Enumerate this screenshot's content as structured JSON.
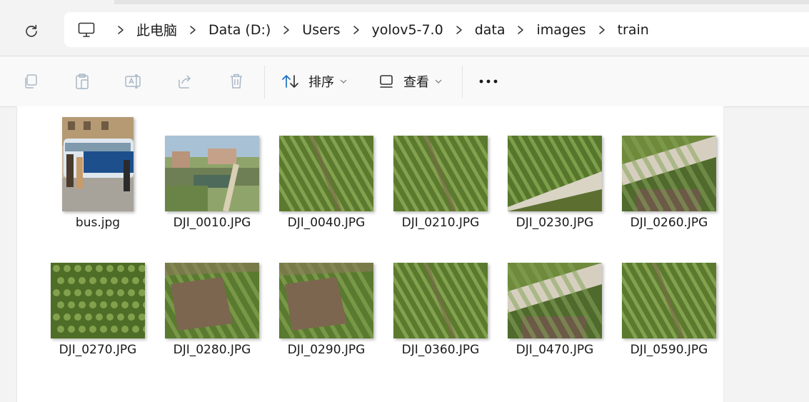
{
  "breadcrumbs": [
    "此电脑",
    "Data (D:)",
    "Users",
    "yolov5-7.0",
    "data",
    "images",
    "train"
  ],
  "toolbar": {
    "sort_label": "排序",
    "view_label": "查看",
    "more_icon": "more-icon"
  },
  "files": [
    {
      "name": "bus.jpg",
      "kind": "bus"
    },
    {
      "name": "DJI_0010.JPG",
      "kind": "town"
    },
    {
      "name": "DJI_0040.JPG",
      "kind": "field"
    },
    {
      "name": "DJI_0210.JPG",
      "kind": "field"
    },
    {
      "name": "DJI_0230.JPG",
      "kind": "field-road"
    },
    {
      "name": "DJI_0260.JPG",
      "kind": "road-soil"
    },
    {
      "name": "DJI_0270.JPG",
      "kind": "grid-field"
    },
    {
      "name": "DJI_0280.JPG",
      "kind": "soil-field"
    },
    {
      "name": "DJI_0290.JPG",
      "kind": "soil-field"
    },
    {
      "name": "DJI_0360.JPG",
      "kind": "field"
    },
    {
      "name": "DJI_0470.JPG",
      "kind": "road-soil"
    },
    {
      "name": "DJI_0590.JPG",
      "kind": "field"
    }
  ]
}
